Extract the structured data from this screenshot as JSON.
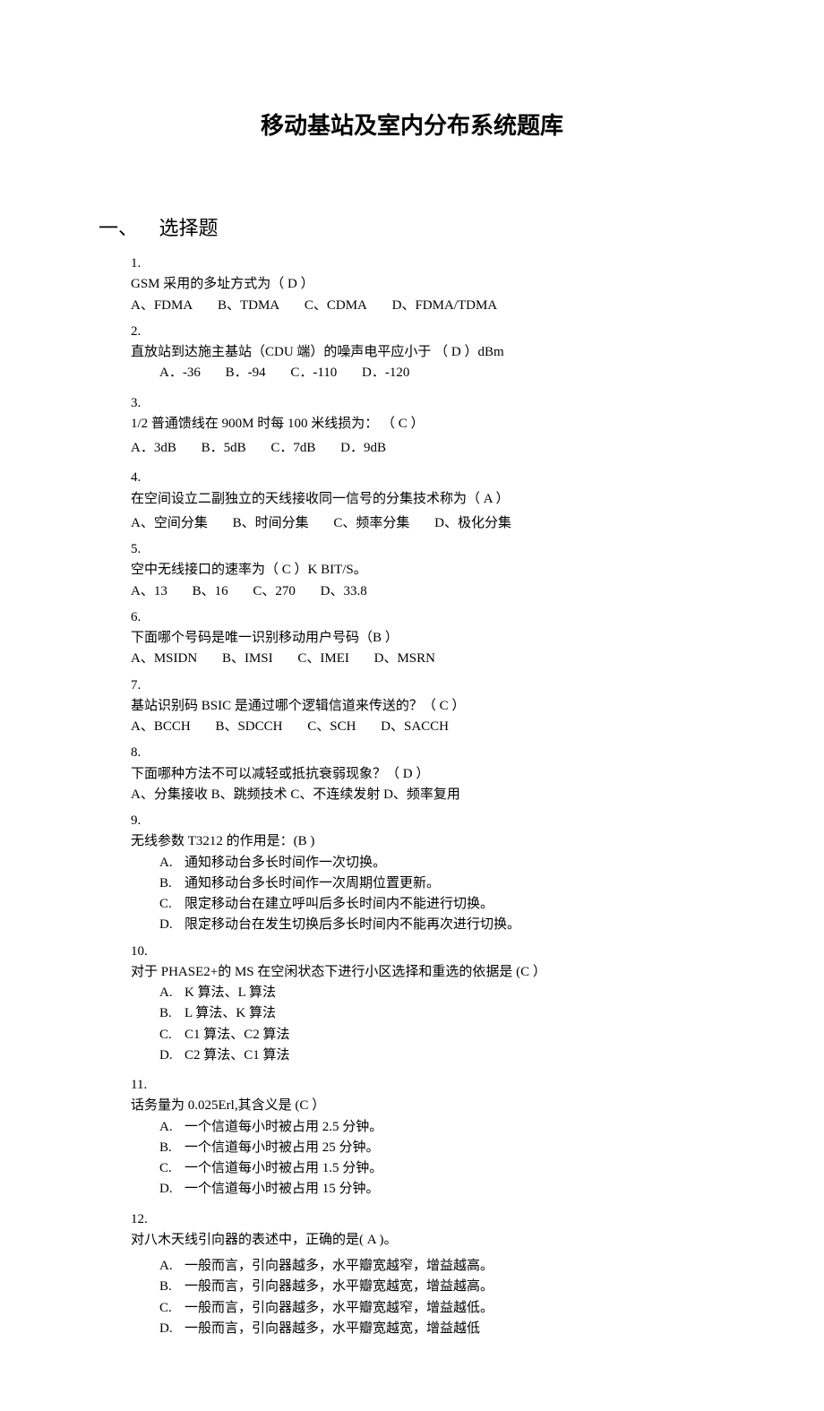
{
  "title": "移动基站及室内分布系统题库",
  "section": {
    "num": "一、",
    "text": "选择题"
  },
  "q": {
    "1": {
      "num": "1.",
      "stem": "GSM 采用的多址方式为（   D  ）",
      "opts": [
        "A、FDMA",
        "B、TDMA",
        "C、CDMA",
        "D、FDMA/TDMA"
      ]
    },
    "2": {
      "num": "2.",
      "stem": "直放站到达施主基站（CDU 端）的噪声电平应小于   （  D   ）dBm",
      "opts": [
        "A．-36",
        "B．-94",
        "C．-110",
        "D．-120"
      ]
    },
    "3": {
      "num": "3.",
      "stem": "1/2 普通馈线在 900M 时每 100 米线损为：  （  C   ）",
      "opts": [
        "A．3dB",
        "B．5dB",
        "C．7dB",
        "D．9dB"
      ]
    },
    "4": {
      "num": "4.",
      "stem": "在空间设立二副独立的天线接收同一信号的分集技术称为（   A   ）",
      "opts": [
        "A、空间分集",
        "B、时间分集",
        "C、频率分集",
        "D、极化分集"
      ]
    },
    "5": {
      "num": "5.",
      "stem": "空中无线接口的速率为（    C ）K BIT/S。",
      "opts": [
        "A、13",
        "B、16",
        "C、270",
        "D、33.8"
      ]
    },
    "6": {
      "num": "6.",
      "stem": "下面哪个号码是唯一识别移动用户号码（B     ）",
      "opts": [
        "A、MSIDN",
        "B、IMSI",
        "C、IMEI",
        "D、MSRN"
      ]
    },
    "7": {
      "num": "7.",
      "stem": "基站识别码 BSIC 是通过哪个逻辑信道来传送的？（    C   ）",
      "opts": [
        "A、BCCH",
        "B、SDCCH",
        "C、SCH",
        "D、SACCH"
      ]
    },
    "8": {
      "num": "8.",
      "stem": "下面哪种方法不可以减轻或抵抗衰弱现象？（   D    ）",
      "opts": [
        "A、分集接收 B、跳频技术 C、不连续发射 D、频率复用"
      ]
    },
    "9": {
      "num": "9.",
      "stem": "无线参数 T3212 的作用是：(B      )",
      "opts": {
        "A": {
          "l": "A.",
          "t": "通知移动台多长时间作一次切换。"
        },
        "B": {
          "l": "B.",
          "t": "通知移动台多长时间作一次周期位置更新。"
        },
        "C": {
          "l": "C.",
          "t": "限定移动台在建立呼叫后多长时间内不能进行切换。"
        },
        "D": {
          "l": "D.",
          "t": "限定移动台在发生切换后多长时间内不能再次进行切换。"
        }
      }
    },
    "10": {
      "num": "10.",
      "stem": "对于 PHASE2+的 MS 在空闲状态下进行小区选择和重选的依据是   (C ）",
      "opts": {
        "A": {
          "l": "A.",
          "t": "K 算法、L 算法"
        },
        "B": {
          "l": "B.",
          "t": "L 算法、K 算法"
        },
        "C": {
          "l": "C.",
          "t": "C1 算法、C2 算法"
        },
        "D": {
          "l": "D.",
          "t": "C2 算法、C1 算法"
        }
      }
    },
    "11": {
      "num": "11.",
      "stem": "话务量为 0.025Erl,其含义是 (C ）",
      "opts": {
        "A": {
          "l": "A.",
          "t": "一个信道每小时被占用 2.5 分钟。"
        },
        "B": {
          "l": "B.",
          "t": "一个信道每小时被占用 25 分钟。"
        },
        "C": {
          "l": "C.",
          "t": "一个信道每小时被占用 1.5 分钟。"
        },
        "D": {
          "l": "D.",
          "t": "一个信道每小时被占用 15 分钟。"
        }
      }
    },
    "12": {
      "num": "12.",
      "stem": "对八木天线引向器的表述中，正确的是( A )。",
      "opts": {
        "A": {
          "l": "A.",
          "t": "一般而言，引向器越多，水平瓣宽越窄，增益越高。"
        },
        "B": {
          "l": "B.",
          "t": "一般而言，引向器越多，水平瓣宽越宽，增益越高。"
        },
        "C": {
          "l": "C.",
          "t": "一般而言，引向器越多，水平瓣宽越窄，增益越低。"
        },
        "D": {
          "l": "D.",
          "t": "一般而言，引向器越多，水平瓣宽越宽，增益越低"
        }
      }
    }
  }
}
